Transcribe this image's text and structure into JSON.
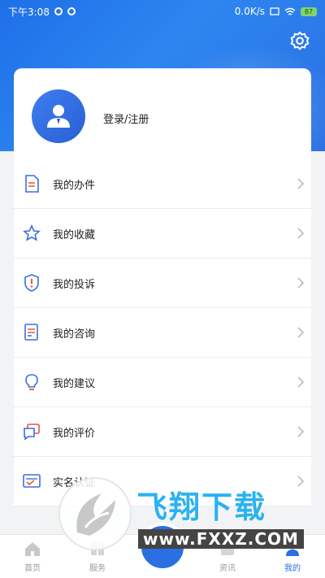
{
  "status_bar": {
    "time": "下午3:08",
    "network_speed": "0.0K/s",
    "battery": "87"
  },
  "profile": {
    "login_label": "登录/注册"
  },
  "menu": [
    {
      "label": "我的办件",
      "icon": "document-icon"
    },
    {
      "label": "我的收藏",
      "icon": "star-icon"
    },
    {
      "label": "我的投诉",
      "icon": "shield-alert-icon"
    },
    {
      "label": "我的咨询",
      "icon": "consult-doc-icon"
    },
    {
      "label": "我的建议",
      "icon": "lightbulb-icon"
    },
    {
      "label": "我的评价",
      "icon": "chat-icon"
    },
    {
      "label": "实名认证",
      "icon": "id-card-icon"
    }
  ],
  "tabbar": [
    {
      "label": "首页",
      "active": false
    },
    {
      "label": "服务",
      "active": false
    },
    {
      "label": "资讯",
      "active": false
    },
    {
      "label": "我的",
      "active": true
    }
  ],
  "watermark": {
    "title": "飞翔下载",
    "url": "www.FXXZ.COM"
  },
  "colors": {
    "primary": "#2a6fe3",
    "accent_red": "#e9543f"
  }
}
